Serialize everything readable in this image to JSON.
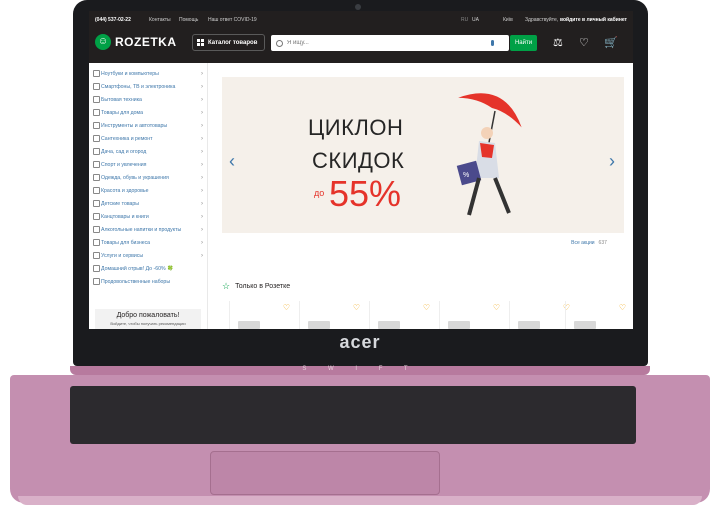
{
  "header": {
    "phone": "(044) 537-02-22",
    "contacts": "Контакты",
    "help": "Помощь",
    "covid": "Наш ответ COVID-19",
    "lang_ru": "RU",
    "lang_ua": "UA",
    "city": "Київ",
    "greeting": "Здравствуйте,",
    "login": "войдите в личный кабинет",
    "logo_text": "ROZETKA",
    "catalog_label": "Каталог товаров",
    "search_placeholder": "Я ищу...",
    "find_button": "Найти"
  },
  "sidebar": {
    "items": [
      {
        "label": "Ноутбуки и компьютеры"
      },
      {
        "label": "Смартфоны, ТВ и электроника"
      },
      {
        "label": "Бытовая техника"
      },
      {
        "label": "Товары для дома"
      },
      {
        "label": "Инструменты и автотовары"
      },
      {
        "label": "Сантехника и ремонт"
      },
      {
        "label": "Дача, сад и огород"
      },
      {
        "label": "Спорт и увлечения"
      },
      {
        "label": "Одежда, обувь и украшения"
      },
      {
        "label": "Красота и здоровье"
      },
      {
        "label": "Детские товары"
      },
      {
        "label": "Канцтовары и книги"
      },
      {
        "label": "Алкогольные напитки и продукты"
      },
      {
        "label": "Товары для бизнеса"
      },
      {
        "label": "Услуги и сервисы"
      },
      {
        "label": "Домашний отрыв! До -60% 🍀"
      },
      {
        "label": "Продовольственные наборы"
      }
    ],
    "welcome_title": "Добро пожаловать!",
    "welcome_sub": "Войдите, чтобы получать рекомендации"
  },
  "banner": {
    "line1": "ЦИКЛОН",
    "line2": "СКИДОК",
    "prefix": "до",
    "percent": "55%",
    "all_actions": "Все акции",
    "all_actions_count": "637"
  },
  "section": {
    "only_rozetka": "Только в Розетке"
  },
  "device": {
    "brand": "acer",
    "model": "S W I F T"
  },
  "colors": {
    "accent_green": "#00a046",
    "header_bg": "#221f1f",
    "link_blue": "#3e77aa",
    "sale_red": "#e5332a"
  }
}
